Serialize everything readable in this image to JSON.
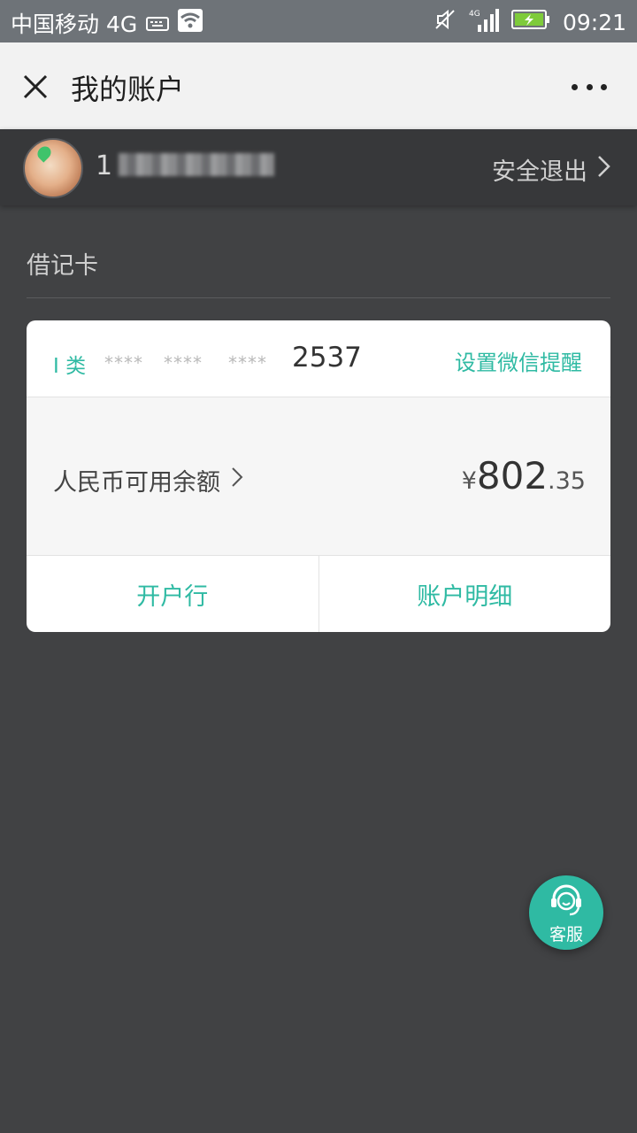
{
  "status_bar": {
    "carrier": "中国移动 4G",
    "time": "09:21"
  },
  "topbar": {
    "title": "我的账户"
  },
  "user": {
    "phone_visible_prefix": "1",
    "logout_label": "安全退出"
  },
  "section": {
    "label": "借记卡"
  },
  "card": {
    "class_label": "I 类",
    "masked_groups": [
      "****",
      "****",
      "****"
    ],
    "last4": "2537",
    "remind_label": "设置微信提醒",
    "balance_label": "人民币可用余额",
    "currency_symbol": "¥",
    "balance_integer": "802",
    "balance_decimal": ".35",
    "bank_button_label": "开户行",
    "detail_button_label": "账户明细"
  },
  "service": {
    "label": "客服"
  },
  "colors": {
    "accent": "#2fbaa3",
    "background": "#414244",
    "topbar": "#f2f2f2",
    "userbar": "#37383a"
  },
  "icons": [
    "keyboard-icon",
    "wifi-icon",
    "mute-icon",
    "signal-icon",
    "battery-charging-icon",
    "close-icon",
    "more-icon",
    "chevron-right-icon",
    "headset-icon"
  ]
}
